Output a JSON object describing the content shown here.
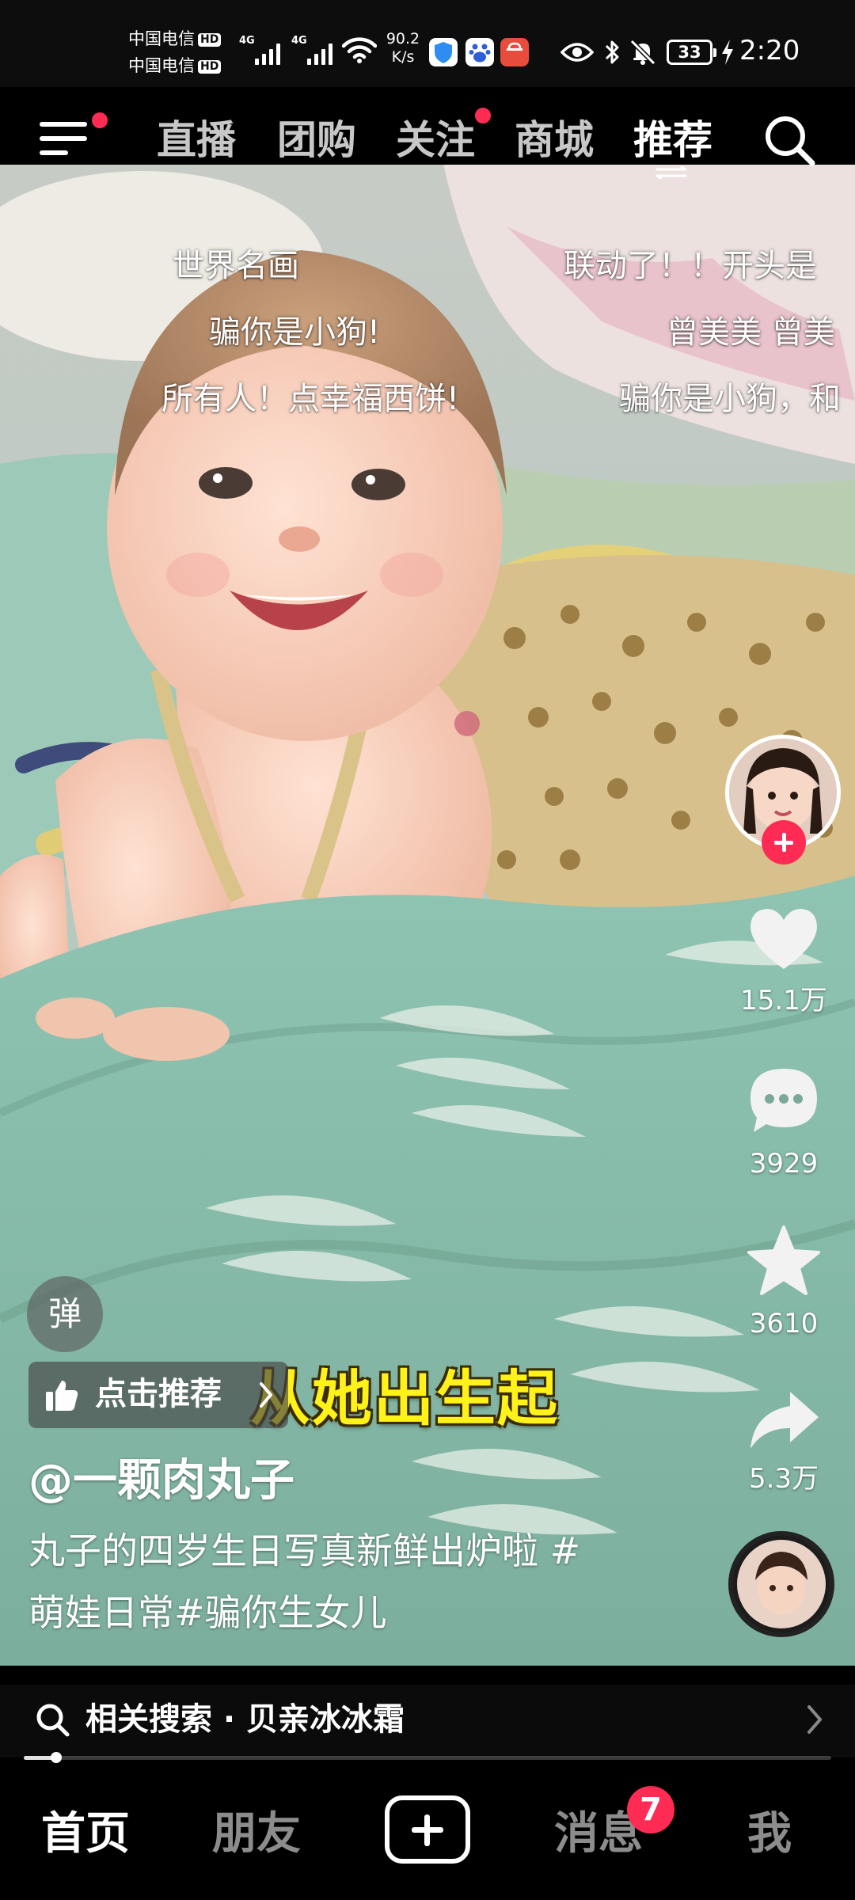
{
  "status_bar": {
    "carrier_1": "中国电信",
    "carrier_2": "中国电信",
    "hd_tag": "HD",
    "network_tag": "4G",
    "net_speed_value": "90.2",
    "net_speed_unit": "K/s",
    "battery_level": "33",
    "time": "2:20"
  },
  "top_tabs": {
    "items": [
      {
        "label": "直播",
        "active": false
      },
      {
        "label": "团购",
        "active": false
      },
      {
        "label": "关注",
        "active": false,
        "dot": true
      },
      {
        "label": "商城",
        "active": false
      },
      {
        "label": "推荐",
        "active": true
      }
    ],
    "menu_has_dot": true,
    "menu_icon": "menu-icon",
    "search_icon": "search-icon"
  },
  "danmaku": [
    "世界名画",
    "骗你是小狗!",
    "所有人！点幸福西饼!",
    "联动了！！开头是",
    "曾美美 曾美",
    "骗你是小狗，和"
  ],
  "video": {
    "caption_overlay": "从她出生起"
  },
  "actions": {
    "like_count": "15.1万",
    "comment_count": "3929",
    "favorite_count": "3610",
    "share_count": "5.3万"
  },
  "danmu_toggle_label": "弹",
  "recommend_chip_label": "点击推荐",
  "author": "@一颗肉丸子",
  "description_line_1": "丸子的四岁生日写真新鲜出炉啦 #",
  "description_line_2": "萌娃日常#骗你生女儿",
  "related_search": "相关搜索 · 贝亲冰冰霜",
  "progress_fraction": 0.04,
  "bottom_nav": {
    "home": "首页",
    "friends": "朋友",
    "messages": "消息",
    "messages_badge": "7",
    "me": "我"
  },
  "colors": {
    "accent": "#fe2c55",
    "caption_yellow": "#fff21a",
    "background": "#000000"
  }
}
